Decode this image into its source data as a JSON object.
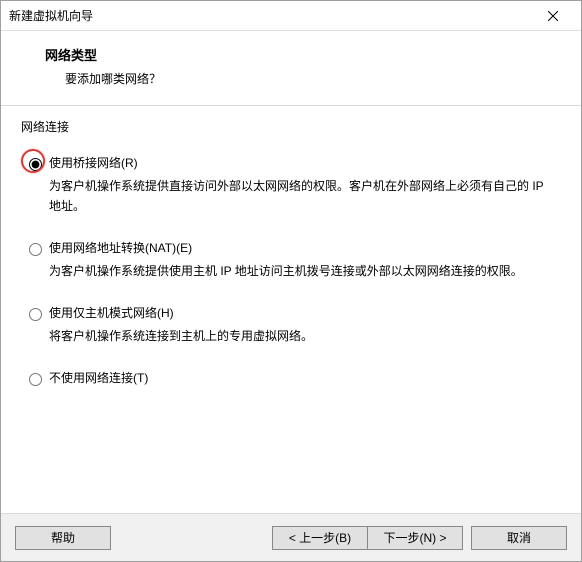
{
  "window": {
    "title": "新建虚拟机向导"
  },
  "header": {
    "title": "网络类型",
    "subtitle": "要添加哪类网络？"
  },
  "group": {
    "label": "网络连接"
  },
  "options": [
    {
      "label": "使用桥接网络(R)",
      "desc": "为客户机操作系统提供直接访问外部以太网网络的权限。客户机在外部网络上必须有自己的 IP 地址。",
      "selected": true,
      "highlight": true
    },
    {
      "label": "使用网络地址转换(NAT)(E)",
      "desc": "为客户机操作系统提供使用主机 IP 地址访问主机拨号连接或外部以太网网络连接的权限。",
      "selected": false,
      "highlight": false
    },
    {
      "label": "使用仅主机模式网络(H)",
      "desc": "将客户机操作系统连接到主机上的专用虚拟网络。",
      "selected": false,
      "highlight": false
    },
    {
      "label": "不使用网络连接(T)",
      "desc": "",
      "selected": false,
      "highlight": false
    }
  ],
  "buttons": {
    "help": "帮助",
    "back": "< 上一步(B)",
    "next": "下一步(N) >",
    "cancel": "取消"
  }
}
